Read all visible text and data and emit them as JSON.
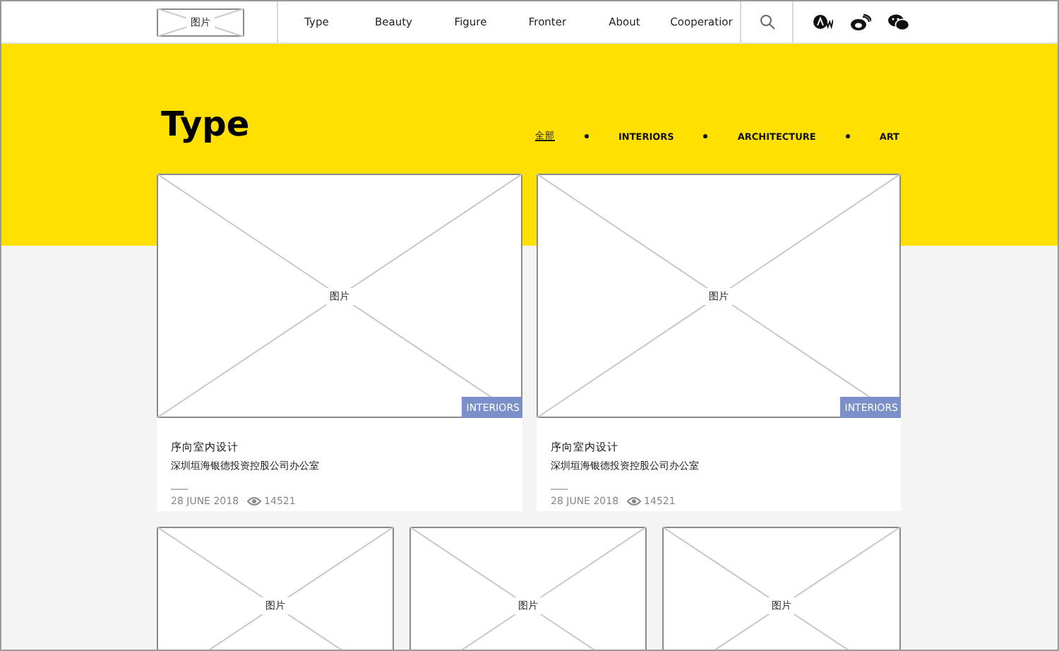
{
  "nav": {
    "logo": "图片",
    "items": [
      {
        "label": "Type"
      },
      {
        "label": "Beauty"
      },
      {
        "label": "Figure"
      },
      {
        "label": "Fronter"
      },
      {
        "label": "About"
      },
      {
        "label": "Cooperatior"
      }
    ]
  },
  "header": {
    "title": "Type",
    "filters": [
      {
        "label": "全部",
        "selected": true
      },
      {
        "label": "INTERIORS",
        "selected": false
      },
      {
        "label": "ARCHITECTURE",
        "selected": false
      },
      {
        "label": "ART",
        "selected": false
      }
    ]
  },
  "featured": [
    {
      "image_label": "图片",
      "tag": "INTERIORS",
      "title": "序向室内设计",
      "subtitle": "深圳垣海银德投资控股公司办公室",
      "date": "28 JUNE 2018",
      "views": "14521"
    },
    {
      "image_label": "图片",
      "tag": "INTERIORS",
      "title": "序向室内设计",
      "subtitle": "深圳垣海银德投资控股公司办公室",
      "date": "28 JUNE 2018",
      "views": "14521"
    }
  ],
  "grid": [
    {
      "image_label": "图片"
    },
    {
      "image_label": "图片"
    },
    {
      "image_label": "图片"
    }
  ]
}
